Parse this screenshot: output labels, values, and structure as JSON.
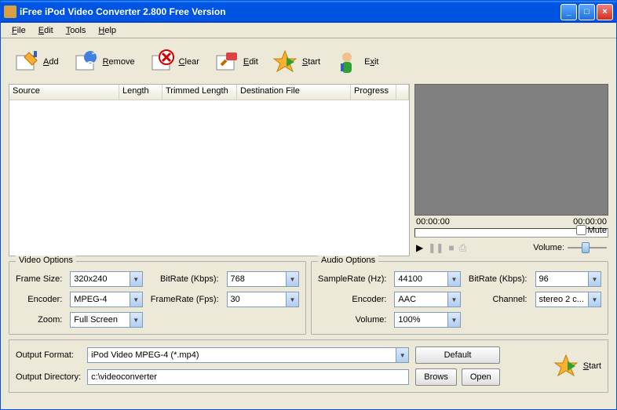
{
  "title": "iFree iPod Video Converter 2.800  Free Version",
  "menu": {
    "file": "File",
    "edit": "Edit",
    "tools": "Tools",
    "help": "Help"
  },
  "toolbar": {
    "add": "Add",
    "remove": "Remove",
    "clear": "Clear",
    "edit": "Edit",
    "start": "Start",
    "exit": "Exit"
  },
  "columns": {
    "source": "Source",
    "length": "Length",
    "trimmed": "Trimmed Length",
    "dest": "Destination File",
    "progress": "Progress"
  },
  "preview": {
    "time_start": "00:00:00",
    "time_end": "00:00:00",
    "mute": "Mute",
    "volume_label": "Volume:"
  },
  "video": {
    "title": "Video Options",
    "frame_size_lbl": "Frame Size:",
    "frame_size": "320x240",
    "bitrate_lbl": "BitRate (Kbps):",
    "bitrate": "768",
    "encoder_lbl": "Encoder:",
    "encoder": "MPEG-4",
    "framerate_lbl": "FrameRate (Fps):",
    "framerate": "30",
    "zoom_lbl": "Zoom:",
    "zoom": "Full Screen"
  },
  "audio": {
    "title": "Audio Options",
    "samplerate_lbl": "SampleRate (Hz):",
    "samplerate": "44100",
    "bitrate_lbl": "BitRate (Kbps):",
    "bitrate": "96",
    "encoder_lbl": "Encoder:",
    "encoder": "AAC",
    "channel_lbl": "Channel:",
    "channel": "stereo 2 c...",
    "volume_lbl": "Volume:",
    "volume": "100%"
  },
  "output": {
    "format_lbl": "Output Format:",
    "format": "iPod Video MPEG-4 (*.mp4)",
    "dir_lbl": "Output Directory:",
    "dir": "c:\\videoconverter",
    "default_btn": "Default",
    "brows_btn": "Brows",
    "open_btn": "Open",
    "start_btn": "Start"
  }
}
